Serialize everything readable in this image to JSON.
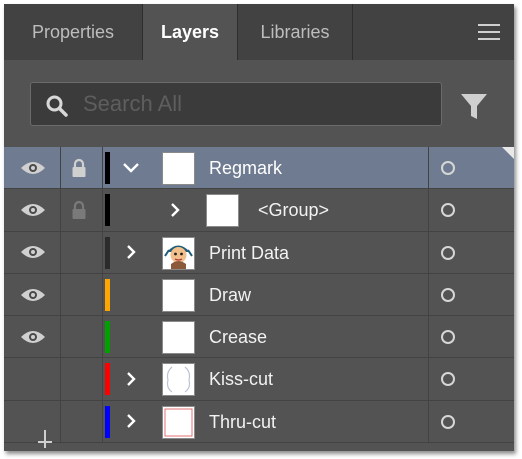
{
  "tabs": [
    {
      "label": "Properties",
      "active": false
    },
    {
      "label": "Layers",
      "active": true
    },
    {
      "label": "Libraries",
      "active": false
    }
  ],
  "search": {
    "placeholder": "Search All"
  },
  "icons": {
    "menu": "hamburger-menu-icon",
    "search": "magnifier-icon",
    "filter": "funnel-icon",
    "visibility": "eye-icon",
    "lock": "padlock-icon",
    "expand": "chevron-right-icon",
    "collapse": "chevron-down-icon",
    "target": "target-circle-icon"
  },
  "colors": {
    "panel_bg": "#535353",
    "tab_bar_bg": "#424242",
    "selected_row": "#6e7b91"
  },
  "layers": [
    {
      "name": "Regmark",
      "visible": true,
      "locked": true,
      "lock_dim": false,
      "color": "#000000",
      "expanded": true,
      "has_children": true,
      "indent": 0,
      "thumb": "blank",
      "selected": true
    },
    {
      "name": "<Group>",
      "visible": true,
      "locked": true,
      "lock_dim": true,
      "color": "#000000",
      "expanded": false,
      "has_children": true,
      "indent": 1,
      "thumb": "blank",
      "selected": false
    },
    {
      "name": "Print Data",
      "visible": true,
      "locked": false,
      "lock_dim": false,
      "color": "#2b2b2b",
      "expanded": false,
      "has_children": true,
      "indent": 0,
      "thumb": "character",
      "selected": false
    },
    {
      "name": "Draw",
      "visible": true,
      "locked": false,
      "lock_dim": false,
      "color": "#ffa500",
      "expanded": false,
      "has_children": false,
      "indent": 0,
      "thumb": "blank",
      "selected": false
    },
    {
      "name": "Crease",
      "visible": true,
      "locked": false,
      "lock_dim": false,
      "color": "#00a000",
      "expanded": false,
      "has_children": false,
      "indent": 0,
      "thumb": "blank",
      "selected": false
    },
    {
      "name": "Kiss-cut",
      "visible": false,
      "locked": false,
      "lock_dim": false,
      "color": "#ff0000",
      "expanded": false,
      "has_children": true,
      "indent": 0,
      "thumb": "outline",
      "selected": false
    },
    {
      "name": "Thru-cut",
      "visible": false,
      "locked": false,
      "lock_dim": false,
      "color": "#0000ff",
      "expanded": false,
      "has_children": true,
      "indent": 0,
      "thumb": "red-frame",
      "selected": false
    }
  ]
}
